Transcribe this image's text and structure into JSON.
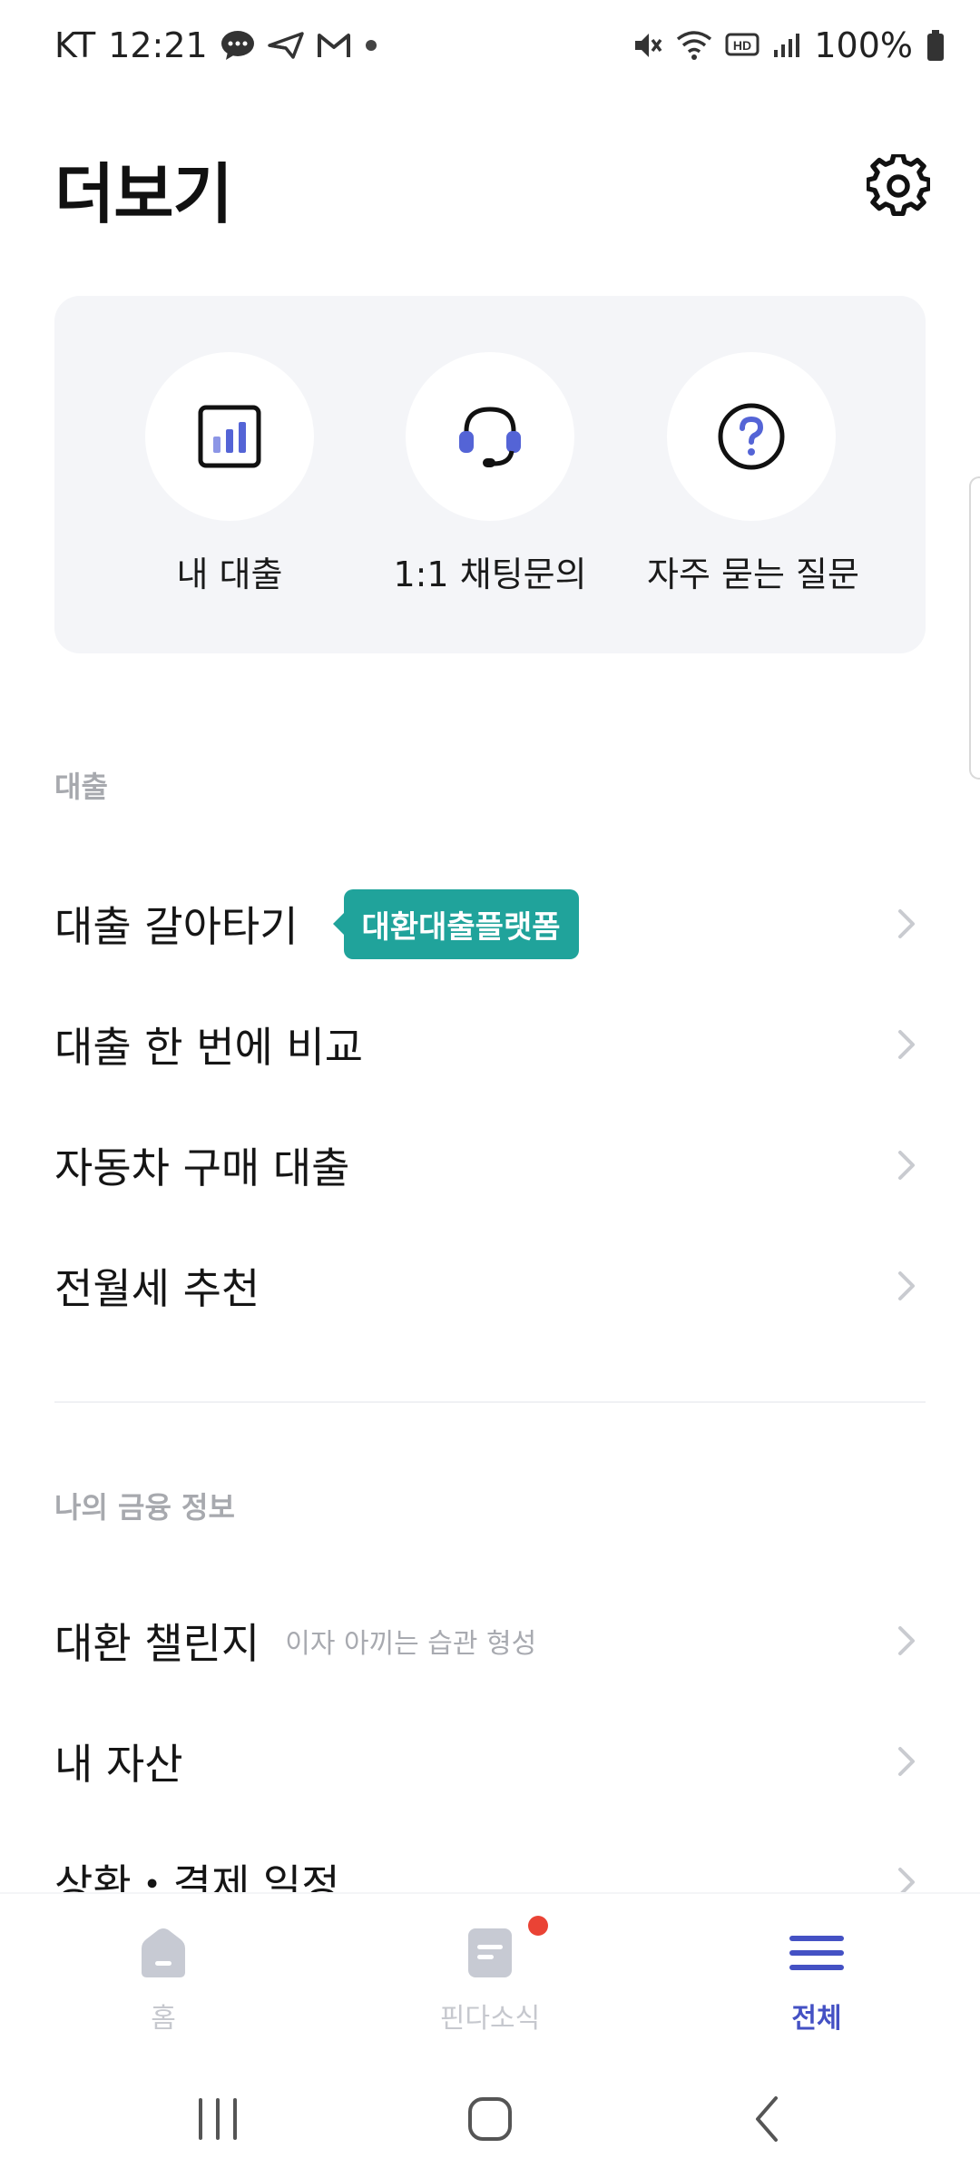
{
  "status_bar": {
    "carrier": "KT",
    "time": "12:21",
    "battery": "100%"
  },
  "header": {
    "title": "더보기"
  },
  "quick_actions": [
    {
      "label": "내 대출",
      "icon": "bar-chart-icon"
    },
    {
      "label": "1:1 채팅문의",
      "icon": "headset-icon"
    },
    {
      "label": "자주 묻는 질문",
      "icon": "question-icon"
    }
  ],
  "loan_section": {
    "heading": "대출",
    "items": [
      {
        "label": "대출 갈아타기",
        "badge": "대환대출플랫폼"
      },
      {
        "label": "대출 한 번에 비교"
      },
      {
        "label": "자동차 구매 대출"
      },
      {
        "label": "전월세 추천"
      }
    ]
  },
  "finance_section": {
    "heading": "나의 금융 정보",
    "items": [
      {
        "label": "대환 챌린지",
        "sub": "이자 아끼는 습관 형성"
      },
      {
        "label": "내 자산"
      },
      {
        "label": "상환・결제 일정"
      }
    ]
  },
  "bottom_nav": {
    "items": [
      {
        "label": "홈",
        "active": false
      },
      {
        "label": "핀다소식",
        "active": false,
        "has_notification": true
      },
      {
        "label": "전체",
        "active": true
      }
    ]
  },
  "colors": {
    "accent": "#4451c4",
    "badge": "#20a39b",
    "icon_blue": "#5464d6",
    "notification": "#ea4335"
  }
}
